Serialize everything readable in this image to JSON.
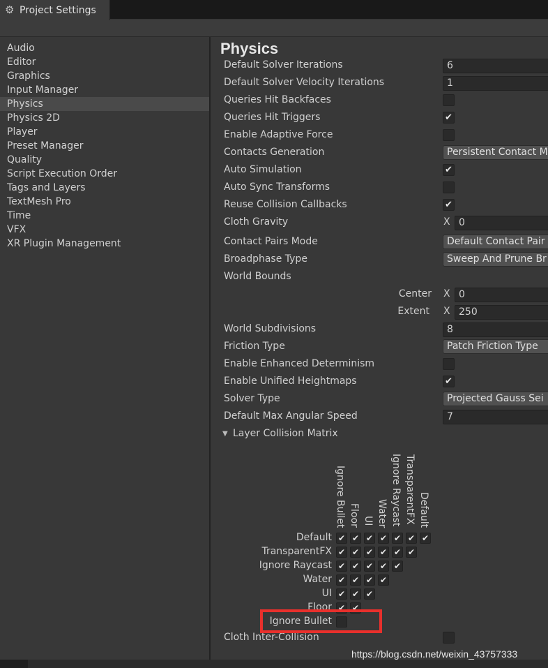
{
  "window": {
    "title": "Project Settings"
  },
  "sidebar": {
    "items": [
      {
        "label": "Audio"
      },
      {
        "label": "Editor"
      },
      {
        "label": "Graphics"
      },
      {
        "label": "Input Manager"
      },
      {
        "label": "Physics",
        "selected": true
      },
      {
        "label": "Physics 2D"
      },
      {
        "label": "Player"
      },
      {
        "label": "Preset Manager"
      },
      {
        "label": "Quality"
      },
      {
        "label": "Script Execution Order"
      },
      {
        "label": "Tags and Layers"
      },
      {
        "label": "TextMesh Pro"
      },
      {
        "label": "Time"
      },
      {
        "label": "VFX"
      },
      {
        "label": "XR Plugin Management"
      }
    ]
  },
  "physics": {
    "title": "Physics",
    "default_solver_iterations": {
      "label": "Default Solver Iterations",
      "value": "6"
    },
    "default_solver_velocity_iterations": {
      "label": "Default Solver Velocity Iterations",
      "value": "1"
    },
    "queries_hit_backfaces": {
      "label": "Queries Hit Backfaces",
      "checked": false
    },
    "queries_hit_triggers": {
      "label": "Queries Hit Triggers",
      "checked": true
    },
    "enable_adaptive_force": {
      "label": "Enable Adaptive Force",
      "checked": false
    },
    "contacts_generation": {
      "label": "Contacts Generation",
      "value": "Persistent Contact M"
    },
    "auto_simulation": {
      "label": "Auto Simulation",
      "checked": true
    },
    "auto_sync_transforms": {
      "label": "Auto Sync Transforms",
      "checked": false
    },
    "reuse_collision_callbacks": {
      "label": "Reuse Collision Callbacks",
      "checked": true
    },
    "cloth_gravity": {
      "label": "Cloth Gravity",
      "axis": "X",
      "value": "0"
    },
    "contact_pairs_mode": {
      "label": "Contact Pairs Mode",
      "value": "Default Contact Pair"
    },
    "broadphase_type": {
      "label": "Broadphase Type",
      "value": "Sweep And Prune Br"
    },
    "world_bounds": {
      "label": "World Bounds",
      "center_label": "Center",
      "center_axis": "X",
      "center_value": "0",
      "extent_label": "Extent",
      "extent_axis": "X",
      "extent_value": "250"
    },
    "world_subdivisions": {
      "label": "World Subdivisions",
      "value": "8"
    },
    "friction_type": {
      "label": "Friction Type",
      "value": "Patch Friction Type"
    },
    "enable_enhanced_determinism": {
      "label": "Enable Enhanced Determinism",
      "checked": false
    },
    "enable_unified_heightmaps": {
      "label": "Enable Unified Heightmaps",
      "checked": true
    },
    "solver_type": {
      "label": "Solver Type",
      "value": "Projected Gauss Sei"
    },
    "default_max_angular_speed": {
      "label": "Default Max Angular Speed",
      "value": "7"
    },
    "layer_collision_matrix": {
      "label": "Layer Collision Matrix",
      "columns": [
        "Ignore Bullet",
        "Floor",
        "UI",
        "Water",
        "Ignore Raycast",
        "TransparentFX",
        "Default"
      ],
      "rows": [
        {
          "label": "Default",
          "cells": [
            true,
            true,
            true,
            true,
            true,
            true,
            true
          ]
        },
        {
          "label": "TransparentFX",
          "cells": [
            true,
            true,
            true,
            true,
            true,
            true
          ]
        },
        {
          "label": "Ignore Raycast",
          "cells": [
            true,
            true,
            true,
            true,
            true
          ]
        },
        {
          "label": "Water",
          "cells": [
            true,
            true,
            true,
            true
          ]
        },
        {
          "label": "UI",
          "cells": [
            true,
            true,
            true
          ]
        },
        {
          "label": "Floor",
          "cells": [
            true,
            true
          ]
        },
        {
          "label": "Ignore Bullet",
          "cells": [
            false
          ]
        }
      ]
    },
    "cloth_inter_collision": {
      "label": "Cloth Inter-Collision",
      "checked": false
    }
  },
  "check_glyph": "✔",
  "watermark": "https://blog.csdn.net/weixin_43757333",
  "colors": {
    "highlight_box": "#e8302c",
    "selected_item": "#4a4a4a"
  }
}
